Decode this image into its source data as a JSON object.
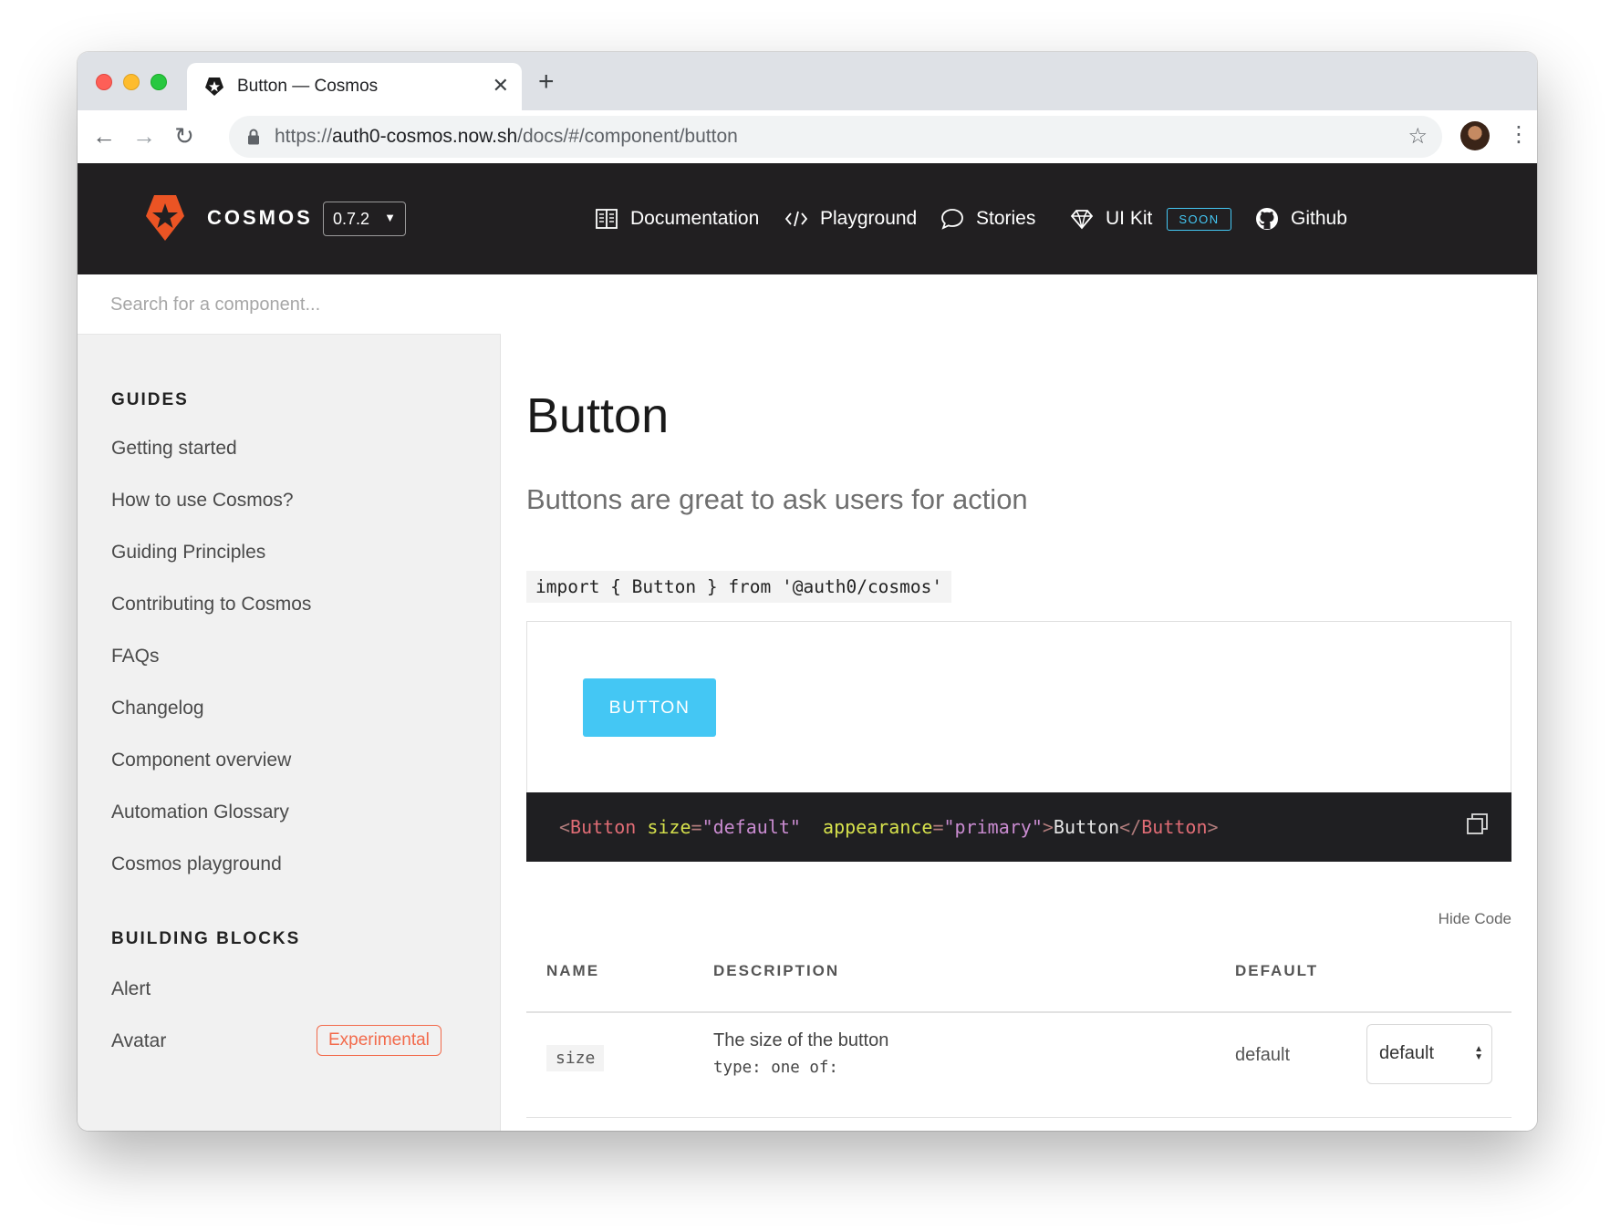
{
  "browser": {
    "tab_title": "Button — Cosmos",
    "tab_close": "✕",
    "new_tab": "+",
    "url_scheme": "https://",
    "url_host": "auth0-cosmos.now.sh",
    "url_path": "/docs/#/component/button",
    "back_icon": "←",
    "forward_icon": "→",
    "reload_icon": "↻",
    "star_icon": "☆",
    "menu_icon": "⋮"
  },
  "header": {
    "brand": "COSMOS",
    "version": "0.7.2",
    "nav": [
      {
        "label": "Documentation",
        "icon": "book-icon"
      },
      {
        "label": "Playground",
        "icon": "code-icon"
      },
      {
        "label": "Stories",
        "icon": "chat-bubble-icon"
      },
      {
        "label": "UI Kit",
        "icon": "diamond-icon",
        "badge": "SOON"
      },
      {
        "label": "Github",
        "icon": "github-icon"
      }
    ],
    "accent_color": "#44c7f4",
    "brand_color": "#eb5424"
  },
  "sidebar": {
    "search_placeholder": "Search for a component...",
    "sections": [
      {
        "title": "GUIDES",
        "items": [
          "Getting started",
          "How to use Cosmos?",
          "Guiding Principles",
          "Contributing to Cosmos",
          "FAQs",
          "Changelog",
          "Component overview",
          "Automation Glossary",
          "Cosmos playground"
        ]
      },
      {
        "title": "BUILDING BLOCKS",
        "items": [
          "Alert",
          "Avatar"
        ],
        "avatar_badge": "Experimental"
      }
    ]
  },
  "main": {
    "title": "Button",
    "description": "Buttons are great to ask users for action",
    "import_code": "import { Button } from '@auth0/cosmos'",
    "demo_button": "BUTTON",
    "code": {
      "open_lt": "<",
      "tag": "Button",
      "attr1": "size",
      "eq": "=",
      "val1": "\"default\"",
      "attr2": "appearance",
      "val2": "\"primary\"",
      "gt": ">",
      "text": "Button",
      "close_open": "</",
      "close_tag": "Button",
      "close_gt": ">"
    },
    "hide_code": "Hide Code",
    "table": {
      "headers": [
        "NAME",
        "DESCRIPTION",
        "DEFAULT"
      ],
      "rows": [
        {
          "name": "size",
          "description": "The size of the button",
          "type": "type: one of:",
          "default": "default",
          "select_value": "default"
        }
      ]
    }
  }
}
